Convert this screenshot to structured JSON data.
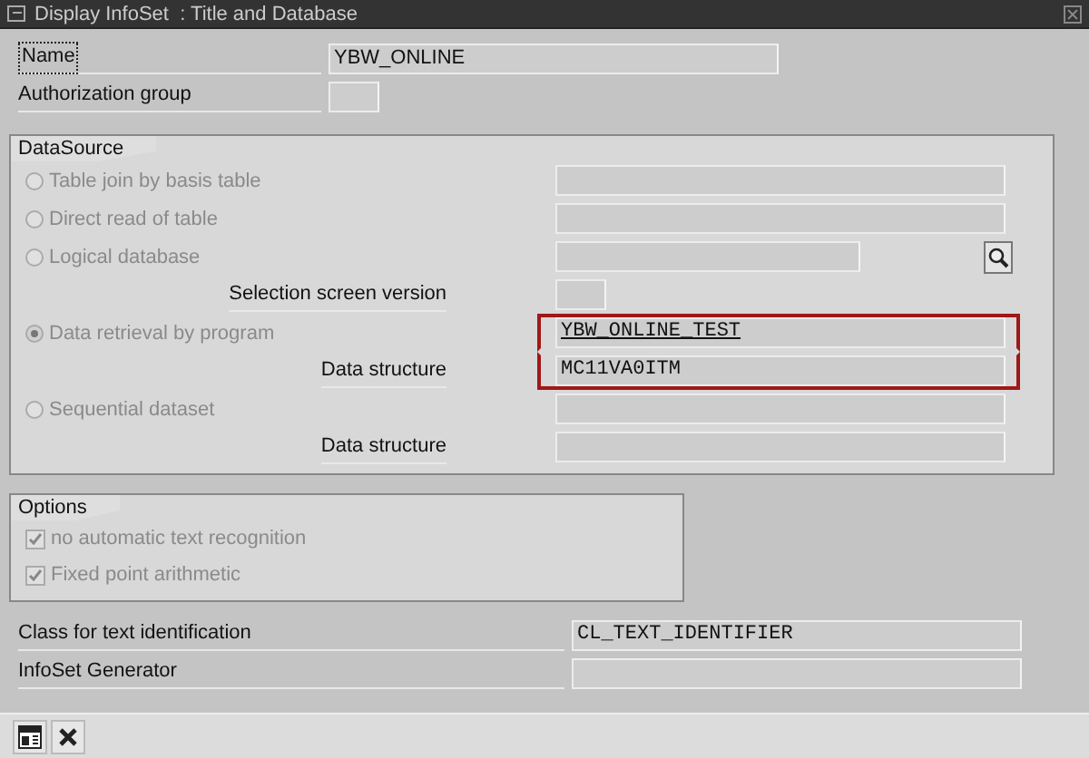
{
  "window": {
    "title": "Display InfoSet  : Title and Database"
  },
  "header_fields": [
    {
      "label": "Name",
      "value": "YBW_ONLINE",
      "focused": true,
      "kind": "wide"
    },
    {
      "label": "Authorization group",
      "focused": false,
      "kind": "tiny"
    }
  ],
  "datasource": {
    "title": "DataSource",
    "rows": [
      {
        "kind": "radio",
        "label": "Table join by basis table",
        "selected": false,
        "field": {
          "kind": "wide"
        },
        "highlighted": false
      },
      {
        "kind": "radio",
        "label": "Direct read of table",
        "selected": false,
        "field": {
          "kind": "wide"
        },
        "highlighted": false
      },
      {
        "kind": "radio",
        "label": "Logical database",
        "selected": false,
        "field": {
          "kind": "short"
        },
        "search_button": true,
        "highlighted": false
      },
      {
        "kind": "sub",
        "label": "Selection screen version",
        "field": {
          "kind": "tiny"
        },
        "highlighted": false
      },
      {
        "kind": "radio",
        "label": "Data retrieval by program",
        "selected": true,
        "field": {
          "kind": "wide",
          "value": "YBW_ONLINE_TEST",
          "link": true
        },
        "highlighted": true
      },
      {
        "kind": "sub",
        "label": "Data structure",
        "field": {
          "kind": "wide",
          "value": "MC11VA0ITM"
        },
        "highlighted": true
      },
      {
        "kind": "radio",
        "label": "Sequential dataset",
        "selected": false,
        "field": {
          "kind": "wide"
        },
        "highlighted": false
      },
      {
        "kind": "sub",
        "label": "Data structure",
        "field": {
          "kind": "wide"
        },
        "highlighted": false
      }
    ]
  },
  "options": {
    "title": "Options",
    "items": [
      {
        "label": "no automatic text recognition",
        "checked": true
      },
      {
        "label": "Fixed point arithmetic",
        "checked": true
      }
    ]
  },
  "footer_fields": [
    {
      "label": "Class for text identification",
      "value": "CL_TEXT_IDENTIFIER"
    },
    {
      "label": "InfoSet Generator"
    }
  ],
  "toolbar": [
    {
      "kind": "layout"
    },
    {
      "kind": "cancel"
    }
  ]
}
